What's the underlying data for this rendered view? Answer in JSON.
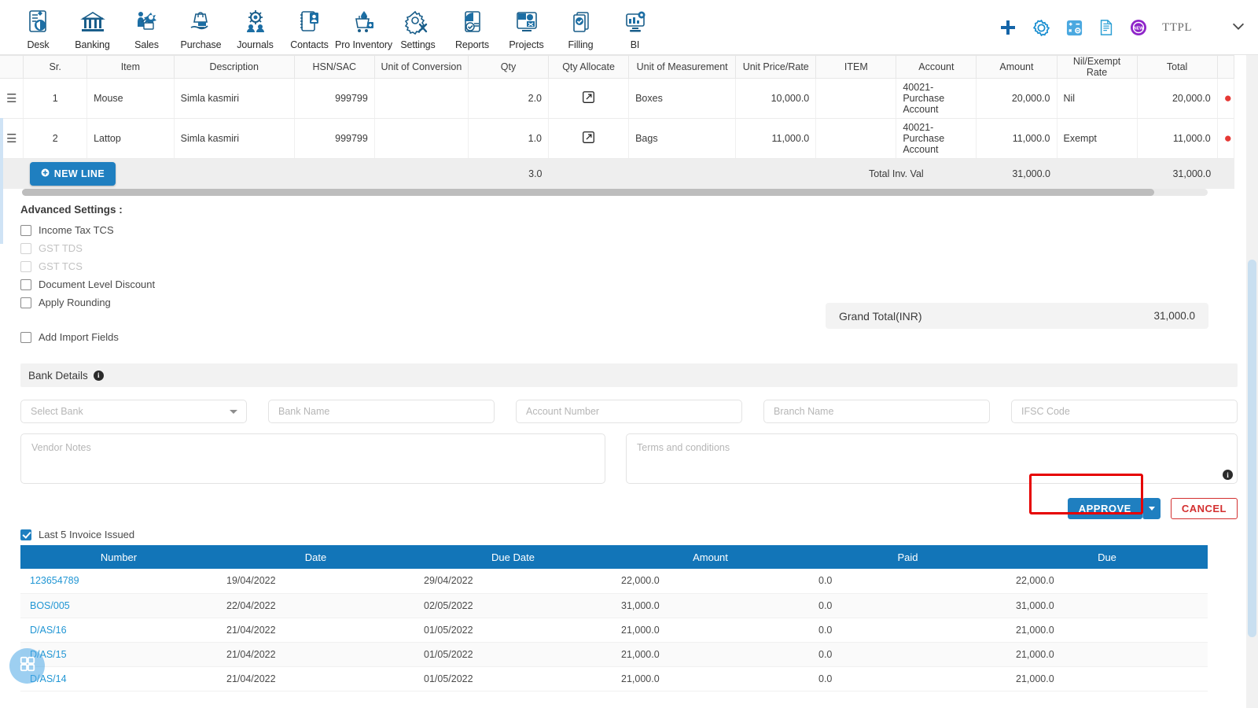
{
  "nav": {
    "items": [
      {
        "label": "Desk",
        "icon": "desk-icon"
      },
      {
        "label": "Banking",
        "icon": "bank-icon"
      },
      {
        "label": "Sales",
        "icon": "sales-icon"
      },
      {
        "label": "Purchase",
        "icon": "purchase-icon"
      },
      {
        "label": "Journals",
        "icon": "journals-icon"
      },
      {
        "label": "Contacts",
        "icon": "contacts-icon"
      },
      {
        "label": "Pro Inventory",
        "icon": "inventory-icon"
      },
      {
        "label": "Settings",
        "icon": "settings-icon"
      },
      {
        "label": "Reports",
        "icon": "reports-icon"
      },
      {
        "label": "Projects",
        "icon": "projects-icon"
      },
      {
        "label": "Filling",
        "icon": "filling-icon"
      },
      {
        "label": "BI",
        "icon": "bi-icon"
      }
    ],
    "right": {
      "add_icon": "plus-icon",
      "settings_icon": "gear-icon",
      "calculator_icon": "calculator-icon",
      "notes_icon": "document-icon",
      "new_badge_icon": "new-badge-icon",
      "org": "TTPL",
      "chevron_icon": "chevron-down-icon"
    }
  },
  "items_table": {
    "columns": [
      "",
      "Sr.",
      "Item",
      "Description",
      "HSN/SAC",
      "Unit of Conversion",
      "Qty",
      "Qty Allocate",
      "Unit of Measurement",
      "Unit Price/Rate",
      "ITEM",
      "Account",
      "Amount",
      "Nil/Exempt Rate",
      "Total",
      ""
    ],
    "rows": [
      {
        "sr": "1",
        "item": "Mouse",
        "description": "Simla kasmiri",
        "hsn": "999799",
        "unit_conversion": "",
        "qty": "2.0",
        "allocate_icon": "external-link-icon",
        "uom": "Boxes",
        "unit_price": "10,000.0",
        "item_col": "",
        "account": "40021-Purchase Account",
        "amount": "20,000.0",
        "nil_exempt": "Nil",
        "total": "20,000.0",
        "delete_icon": "delete-icon"
      },
      {
        "sr": "2",
        "item": "Lattop",
        "description": "Simla kasmiri",
        "hsn": "999799",
        "unit_conversion": "",
        "qty": "1.0",
        "allocate_icon": "external-link-icon",
        "uom": "Bags",
        "unit_price": "11,000.0",
        "item_col": "",
        "account": "40021-Purchase Account",
        "amount": "11,000.0",
        "nil_exempt": "Exempt",
        "total": "11,000.0",
        "delete_icon": "delete-icon"
      }
    ],
    "footer": {
      "new_line_label": "NEW LINE",
      "qty_total": "3.0",
      "total_label": "Total Inv. Val",
      "amount_total": "31,000.0",
      "grand_total": "31,000.0"
    }
  },
  "advanced": {
    "title": "Advanced Settings :",
    "options": [
      {
        "label": "Income Tax TCS",
        "checked": false,
        "disabled": false
      },
      {
        "label": "GST TDS",
        "checked": false,
        "disabled": true
      },
      {
        "label": "GST TCS",
        "checked": false,
        "disabled": true
      },
      {
        "label": "Document Level Discount",
        "checked": false,
        "disabled": false
      },
      {
        "label": "Apply Rounding",
        "checked": false,
        "disabled": false
      }
    ],
    "import_fields": {
      "label": "Add Import Fields",
      "checked": false
    }
  },
  "grand_total": {
    "label": "Grand Total(INR)",
    "value": "31,000.0"
  },
  "bank": {
    "header": "Bank Details",
    "info_icon": "info-icon",
    "fields": [
      {
        "placeholder": "Select Bank",
        "type": "select",
        "name": "select-bank-dropdown"
      },
      {
        "placeholder": "Bank Name",
        "type": "text",
        "name": "bank-name-input"
      },
      {
        "placeholder": "Account Number",
        "type": "text",
        "name": "account-number-input"
      },
      {
        "placeholder": "Branch Name",
        "type": "text",
        "name": "branch-name-input"
      },
      {
        "placeholder": "IFSC Code",
        "type": "text",
        "name": "ifsc-code-input"
      }
    ]
  },
  "notes": {
    "vendor_placeholder": "Vendor Notes",
    "terms_placeholder": "Terms and conditions",
    "terms_info_icon": "info-icon"
  },
  "actions": {
    "approve_label": "APPROVE",
    "approve_caret_icon": "caret-down-icon",
    "cancel_label": "CANCEL",
    "highlight_color": "#e60000"
  },
  "invoices": {
    "checkbox_label": "Last 5 Invoice Issued",
    "checked": true,
    "columns": [
      "Number",
      "Date",
      "Due Date",
      "Amount",
      "Paid",
      "Due"
    ],
    "rows": [
      {
        "number": "123654789",
        "date": "19/04/2022",
        "due_date": "29/04/2022",
        "amount": "22,000.0",
        "paid": "0.0",
        "due": "22,000.0"
      },
      {
        "number": "BOS/005",
        "date": "22/04/2022",
        "due_date": "02/05/2022",
        "amount": "31,000.0",
        "paid": "0.0",
        "due": "31,000.0"
      },
      {
        "number": "D/AS/16",
        "date": "21/04/2022",
        "due_date": "01/05/2022",
        "amount": "21,000.0",
        "paid": "0.0",
        "due": "21,000.0"
      },
      {
        "number": "D/AS/15",
        "date": "21/04/2022",
        "due_date": "01/05/2022",
        "amount": "21,000.0",
        "paid": "0.0",
        "due": "21,000.0"
      },
      {
        "number": "D/AS/14",
        "date": "21/04/2022",
        "due_date": "01/05/2022",
        "amount": "21,000.0",
        "paid": "0.0",
        "due": "21,000.0"
      }
    ]
  },
  "fab": {
    "icon": "apps-grid-icon"
  },
  "colors": {
    "primary": "#1f7fc0",
    "table_header": "#1275b8",
    "link": "#2196d4",
    "danger": "#d32f2f"
  }
}
